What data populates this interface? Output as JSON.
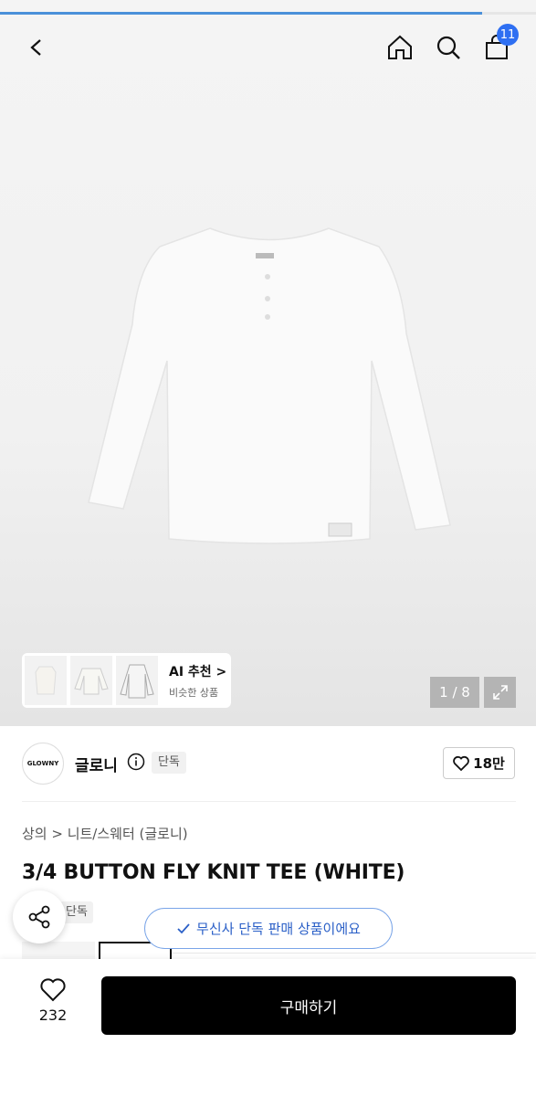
{
  "progress": {
    "fraction": 0.9
  },
  "header": {
    "back_icon": "chevron-left-icon",
    "home_icon": "home-icon",
    "search_icon": "search-icon",
    "cart_icon": "shopping-bag-icon",
    "cart_count": "11"
  },
  "gallery": {
    "ai_title": "AI 추천 >",
    "ai_subtitle": "비슷한 상품",
    "pager": "1 / 8",
    "expand_icon": "expand-icon"
  },
  "brand": {
    "logo_text": "GLOWNY",
    "name": "글로니",
    "exclusive": "단독",
    "likes": "18만"
  },
  "product": {
    "breadcrumb": "상의 > 니트/스웨터 (글로니)",
    "title": "3/4 BUTTON FLY KNIT TEE (WHITE)",
    "tag": "단독"
  },
  "toast": {
    "text": "무신사 단독 판매 상품이에요"
  },
  "bottom": {
    "wish_count": "232",
    "buy_label": "구매하기"
  },
  "colors": {
    "accent": "#2e6ff2",
    "toast_text": "#2a5fc7",
    "buy_bg": "#000000"
  }
}
